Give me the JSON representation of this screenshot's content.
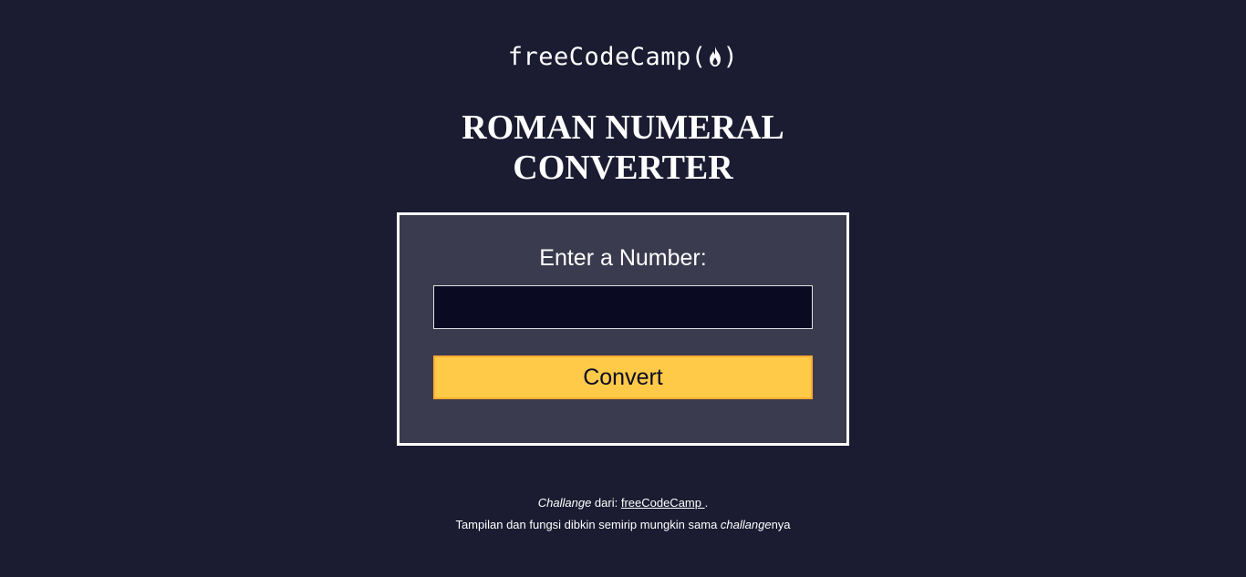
{
  "header": {
    "logo_text": "freeCodeCamp",
    "logo_open": "(",
    "logo_close": ")",
    "logo_icon": "flame-icon"
  },
  "title": {
    "line1": "ROMAN NUMERAL",
    "line2": "CONVERTER"
  },
  "form": {
    "label": "Enter a Number:",
    "input_value": "",
    "input_placeholder": "",
    "button_label": "Convert"
  },
  "footer": {
    "line1_italic": "Challange",
    "line1_text": " dari: ",
    "line1_link": "freeCodeCamp ",
    "line1_end": ".",
    "line2_text": "Tampilan dan fungsi dibkin semirip mungkin sama ",
    "line2_italic": "challange",
    "line2_end": "nya"
  },
  "colors": {
    "background": "#1b1b32",
    "card": "#3b3b4f",
    "input": "#0a0a23",
    "button": "#feca47",
    "button_border": "#feac32"
  }
}
